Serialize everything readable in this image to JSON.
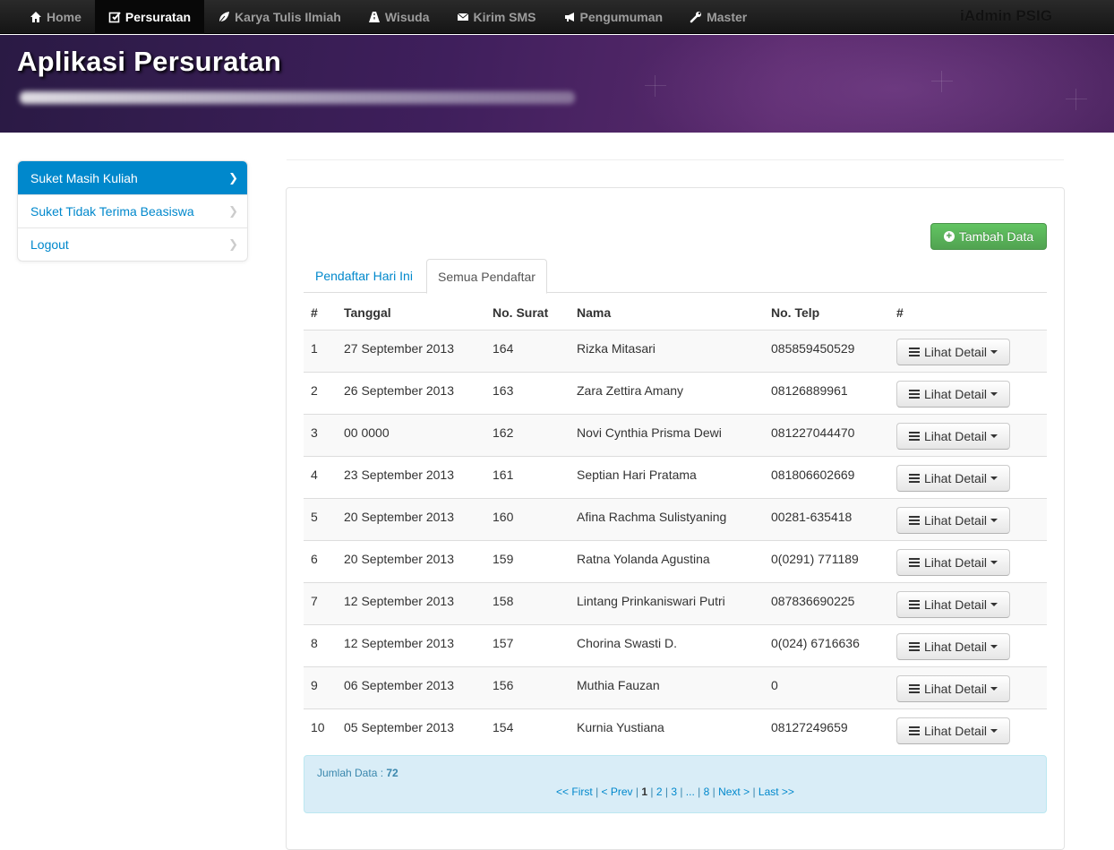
{
  "nav": {
    "items": [
      {
        "label": "Home",
        "icon": "home-icon"
      },
      {
        "label": "Persuratan",
        "icon": "edit-icon"
      },
      {
        "label": "Karya Tulis Ilmiah",
        "icon": "leaf-icon"
      },
      {
        "label": "Wisuda",
        "icon": "road-icon"
      },
      {
        "label": "Kirim SMS",
        "icon": "envelope-icon"
      },
      {
        "label": "Pengumuman",
        "icon": "bullhorn-icon"
      },
      {
        "label": "Master",
        "icon": "wrench-icon"
      }
    ],
    "active": "Persuratan",
    "brand": "iAdmin PSIG"
  },
  "header": {
    "title": "Aplikasi Persuratan"
  },
  "sidebar": {
    "items": [
      {
        "label": "Suket Masih Kuliah"
      },
      {
        "label": "Suket Tidak Terima Beasiswa"
      },
      {
        "label": "Logout"
      }
    ]
  },
  "main": {
    "add_button": "Tambah Data",
    "tabs": [
      {
        "label": "Pendaftar Hari Ini"
      },
      {
        "label": "Semua Pendaftar"
      }
    ],
    "active_tab": "Semua Pendaftar",
    "table": {
      "headers": [
        "#",
        "Tanggal",
        "No. Surat",
        "Nama",
        "No. Telp",
        "#"
      ],
      "action_label": "Lihat Detail",
      "rows": [
        {
          "no": "1",
          "tanggal": "27 September 2013",
          "surat": "164",
          "nama": "Rizka Mitasari",
          "telp": "085859450529"
        },
        {
          "no": "2",
          "tanggal": "26 September 2013",
          "surat": "163",
          "nama": "Zara Zettira Amany",
          "telp": "08126889961"
        },
        {
          "no": "3",
          "tanggal": "00 0000",
          "surat": "162",
          "nama": "Novi Cynthia Prisma Dewi",
          "telp": "081227044470"
        },
        {
          "no": "4",
          "tanggal": "23 September 2013",
          "surat": "161",
          "nama": "Septian Hari Pratama",
          "telp": "081806602669"
        },
        {
          "no": "5",
          "tanggal": "20 September 2013",
          "surat": "160",
          "nama": "Afina Rachma Sulistyaning",
          "telp": "00281-635418"
        },
        {
          "no": "6",
          "tanggal": "20 September 2013",
          "surat": "159",
          "nama": "Ratna Yolanda Agustina",
          "telp": "0(0291) 771189"
        },
        {
          "no": "7",
          "tanggal": "12 September 2013",
          "surat": "158",
          "nama": "Lintang Prinkaniswari Putri",
          "telp": "087836690225"
        },
        {
          "no": "8",
          "tanggal": "12 September 2013",
          "surat": "157",
          "nama": "Chorina Swasti D.",
          "telp": "0(024) 6716636"
        },
        {
          "no": "9",
          "tanggal": "06 September 2013",
          "surat": "156",
          "nama": "Muthia Fauzan",
          "telp": "0"
        },
        {
          "no": "10",
          "tanggal": "05 September 2013",
          "surat": "154",
          "nama": "Kurnia Yustiana",
          "telp": "08127249659"
        }
      ]
    },
    "footer": {
      "jumlah_label": "Jumlah Data : ",
      "jumlah_value": "72",
      "pager": [
        {
          "label": "<< First",
          "current": false
        },
        {
          "label": "< Prev",
          "current": false
        },
        {
          "label": "1",
          "current": true
        },
        {
          "label": "2",
          "current": false
        },
        {
          "label": "3",
          "current": false
        },
        {
          "label": "...",
          "current": false
        },
        {
          "label": "8",
          "current": false
        },
        {
          "label": "Next >",
          "current": false
        },
        {
          "label": "Last >>",
          "current": false
        }
      ]
    }
  },
  "colors": {
    "primary": "#0088cc",
    "success": "#51a351",
    "info_bg": "#d9edf7",
    "navbar": "#1b1b1b",
    "banner": "#3f1f5c"
  }
}
